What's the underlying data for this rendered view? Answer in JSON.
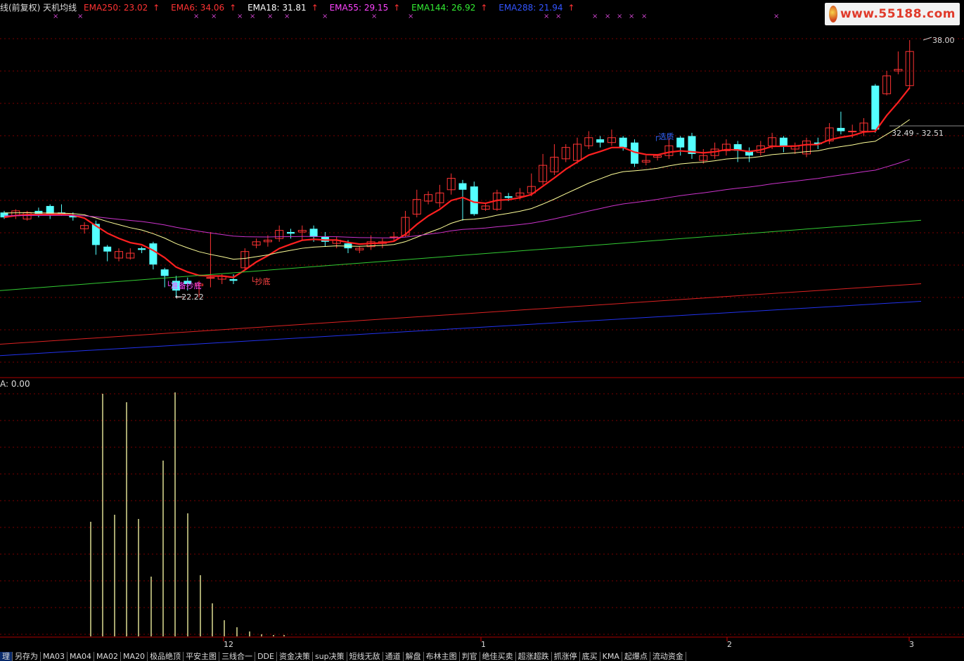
{
  "legend": {
    "prefix": "线(前复权) 天机均线",
    "items": [
      {
        "label": "EMA250: 23.02",
        "color": "#ff3333"
      },
      {
        "label": "EMA6: 34.06",
        "color": "#ff3333"
      },
      {
        "label": "EMA18: 31.81",
        "color": "#ffffff"
      },
      {
        "label": "EMA55: 29.15",
        "color": "#ff44ff"
      },
      {
        "label": "EMA144: 26.92",
        "color": "#33ee33"
      },
      {
        "label": "EMA288: 21.94",
        "color": "#3355ff"
      }
    ],
    "arrow": "↑"
  },
  "logo": {
    "text": "www.55188.com"
  },
  "annotations": {
    "high": "38.00",
    "low": "22.22",
    "range": "32.49 - 32.51",
    "select": "选质",
    "buy_label": "抄底",
    "mark_label": "准备抄底"
  },
  "sub_legend": "A: 0.00",
  "months": [
    "12",
    "1",
    "2",
    "3"
  ],
  "toolbar": [
    "理",
    "另存为",
    "MA03",
    "MA04",
    "MA02",
    "MA20",
    "极品绝顶",
    "平安主图",
    "三线合一",
    "DDE",
    "资金决策",
    "sup决策",
    "短线无敌",
    "通道",
    "解盘",
    "布林主图",
    "判官",
    "绝佳买卖",
    "超涨超跌",
    "抓涨停",
    "底买",
    "KMA",
    "起爆点",
    "流动资金"
  ],
  "colors": {
    "up": "#ff3333",
    "down": "#54ffff",
    "ema6": "#ff2020",
    "ema18": "#ffff99",
    "ema55": "#cc33cc",
    "ema144": "#33cc33",
    "ema250": "#dd2222",
    "ema288": "#2233ee",
    "grid": "#7a0000",
    "volume": "#ffffaa"
  }
}
